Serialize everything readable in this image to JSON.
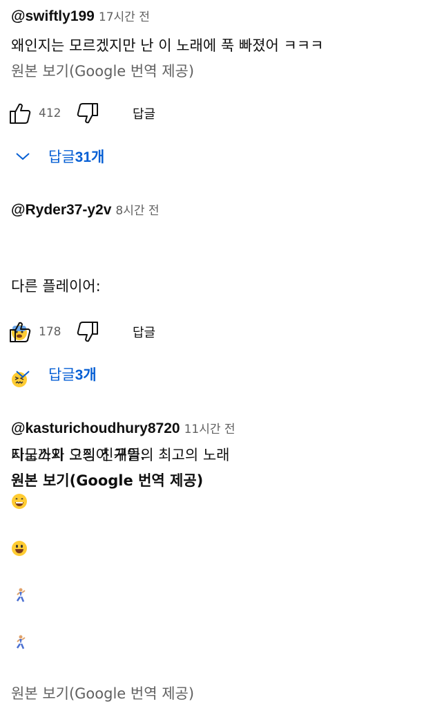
{
  "comments": [
    {
      "author": "@swiftly199",
      "time": "17시간 전",
      "text": "왜인지는 모르겠지만 난 이 노래에 푹 빠졌어 ㅋㅋㅋ",
      "translate": "원본 보기(Google 번역 제공)",
      "likes": "412",
      "reply_label": "답글",
      "replies_prefix": "답글 ",
      "replies_count": "31개"
    },
    {
      "author": "@Ryder37-y2v",
      "time": "8시간 전",
      "text_line1": "다른 플레이어:",
      "text_line2": "타노스와 그의 친구들:",
      "translate": "원본 보기(Google 번역 제공)",
      "likes": "178",
      "reply_label": "답글",
      "replies_prefix": "답글 ",
      "replies_count": "3개"
    },
    {
      "author": "@kasturichoudhury8720",
      "time": "11시간 전",
      "text": "지금까지 오징어 게임의 최고의 노래",
      "translate": "원본 보기(Google 번역 제공)"
    }
  ],
  "icons": {
    "like": "thumbs-up-icon",
    "dislike": "thumbs-down-icon",
    "expand": "chevron-down-icon"
  },
  "colors": {
    "link_blue": "#065fd4",
    "secondary_text": "#606060",
    "primary_text": "#0f0f0f"
  }
}
